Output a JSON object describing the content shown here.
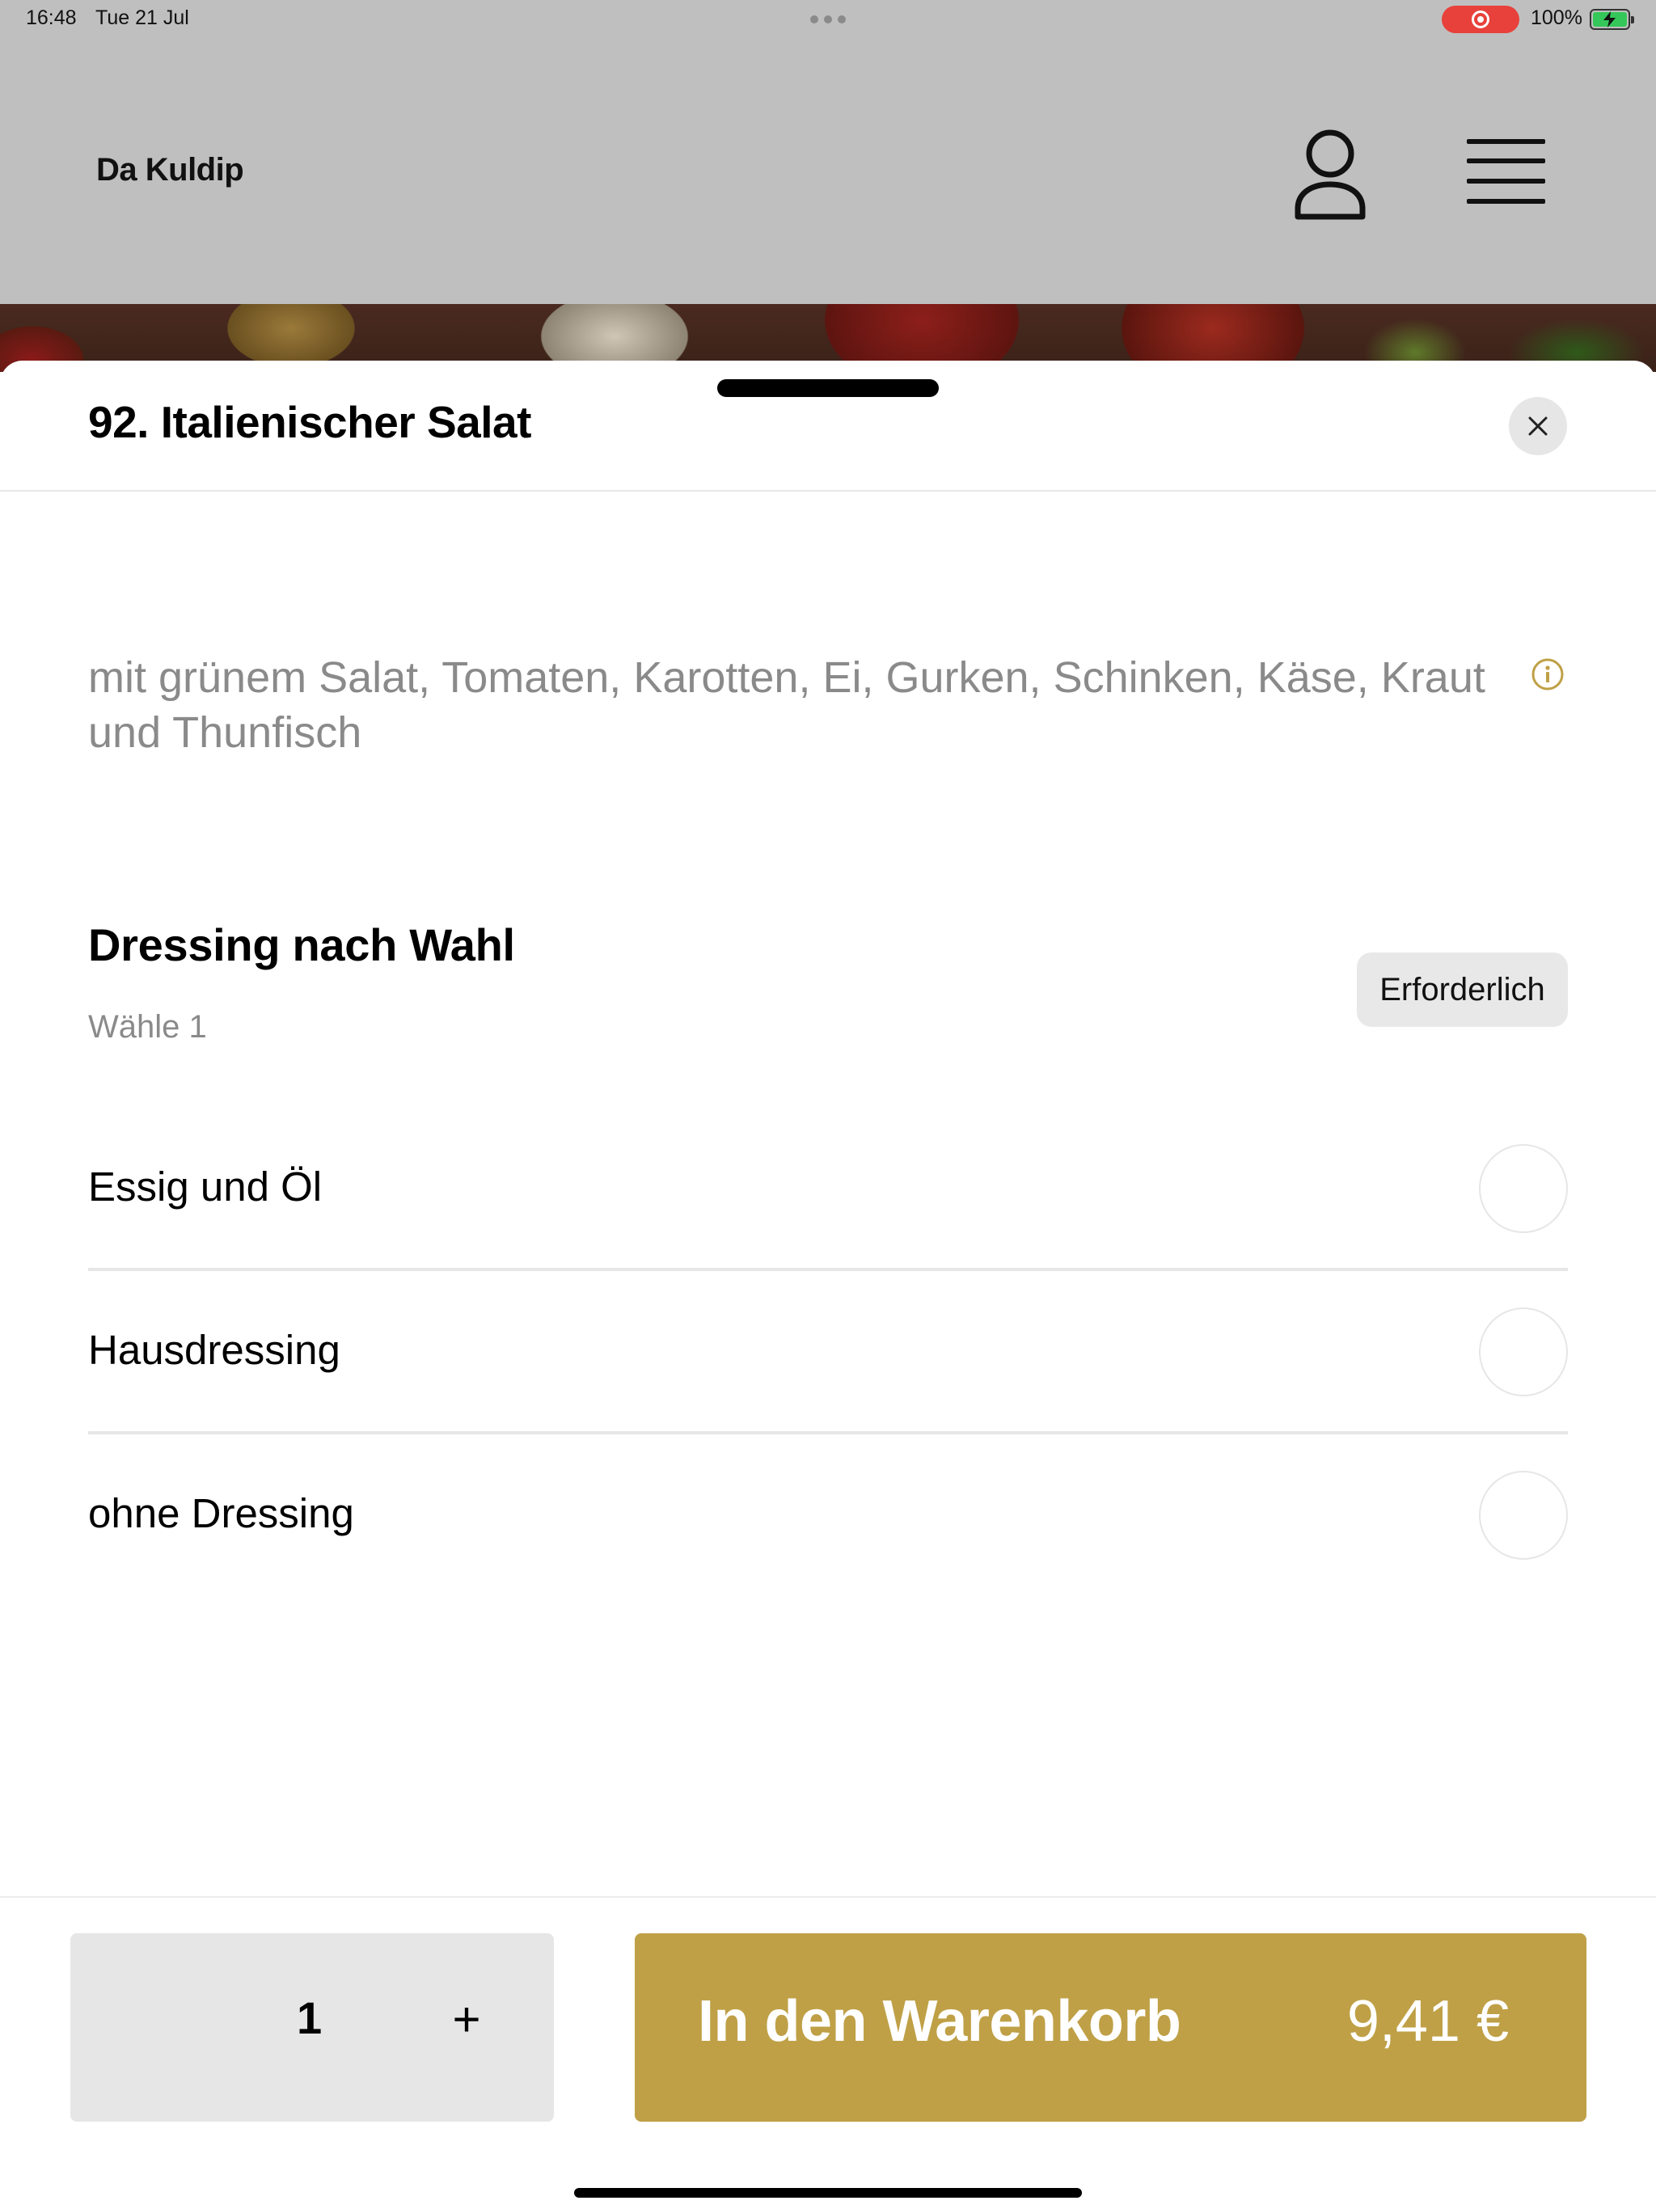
{
  "status_bar": {
    "time": "16:48",
    "date": "Tue 21 Jul",
    "battery_percent": "100%",
    "battery_level": 1.0,
    "screen_recording": true
  },
  "app": {
    "brand": "Da Kuldip",
    "profile_icon": "person-outline-icon",
    "menu_icon": "hamburger-menu-icon"
  },
  "sheet": {
    "title": "92. Italienischer Salat",
    "close_icon": "close-x-icon",
    "description": "mit grünem Salat, Tomaten, Karotten, Ei, Gurken, Schinken, Käse, Kraut und Thunfisch",
    "info_icon": "info-circle-icon",
    "info_icon_color": "#bfa046"
  },
  "option_group": {
    "title": "Dressing nach Wahl",
    "subtitle": "Wähle 1",
    "badge": "Erforderlich",
    "options": [
      {
        "label": "Essig und Öl",
        "selected": false
      },
      {
        "label": "Hausdressing",
        "selected": false
      },
      {
        "label": "ohne Dressing",
        "selected": false
      }
    ]
  },
  "footer": {
    "quantity": "1",
    "increment_label": "+",
    "add_to_cart_label": "In den Warenkorb",
    "price": "9,41 €",
    "accent_color": "#bfa046"
  }
}
